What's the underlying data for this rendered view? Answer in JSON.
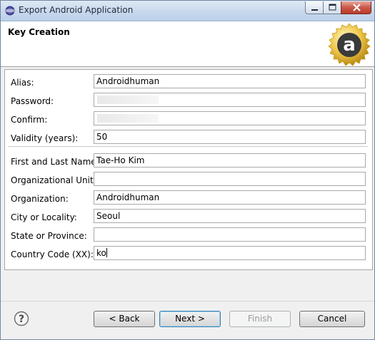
{
  "window": {
    "title": "Export Android Application"
  },
  "banner": {
    "title": "Key Creation",
    "logo_letter": "a"
  },
  "form": {
    "fields": [
      {
        "label": "Alias:",
        "value": "Androidhuman"
      },
      {
        "label": "Password:",
        "value": ""
      },
      {
        "label": "Confirm:",
        "value": ""
      },
      {
        "label": "Validity (years):",
        "value": "50"
      },
      {
        "label": "First and Last Name:",
        "value": "Tae-Ho Kim"
      },
      {
        "label": "Organizational Unit:",
        "value": ""
      },
      {
        "label": "Organization:",
        "value": "Androidhuman"
      },
      {
        "label": "City or Locality:",
        "value": "Seoul"
      },
      {
        "label": "State or Province:",
        "value": ""
      },
      {
        "label": "Country Code (XX):",
        "value": "ko"
      }
    ]
  },
  "buttons": {
    "back": "< Back",
    "next": "Next >",
    "finish": "Finish",
    "cancel": "Cancel"
  },
  "icons": {
    "title": "eclipse-icon",
    "help": "help-icon",
    "logo": "android-logo-icon"
  }
}
